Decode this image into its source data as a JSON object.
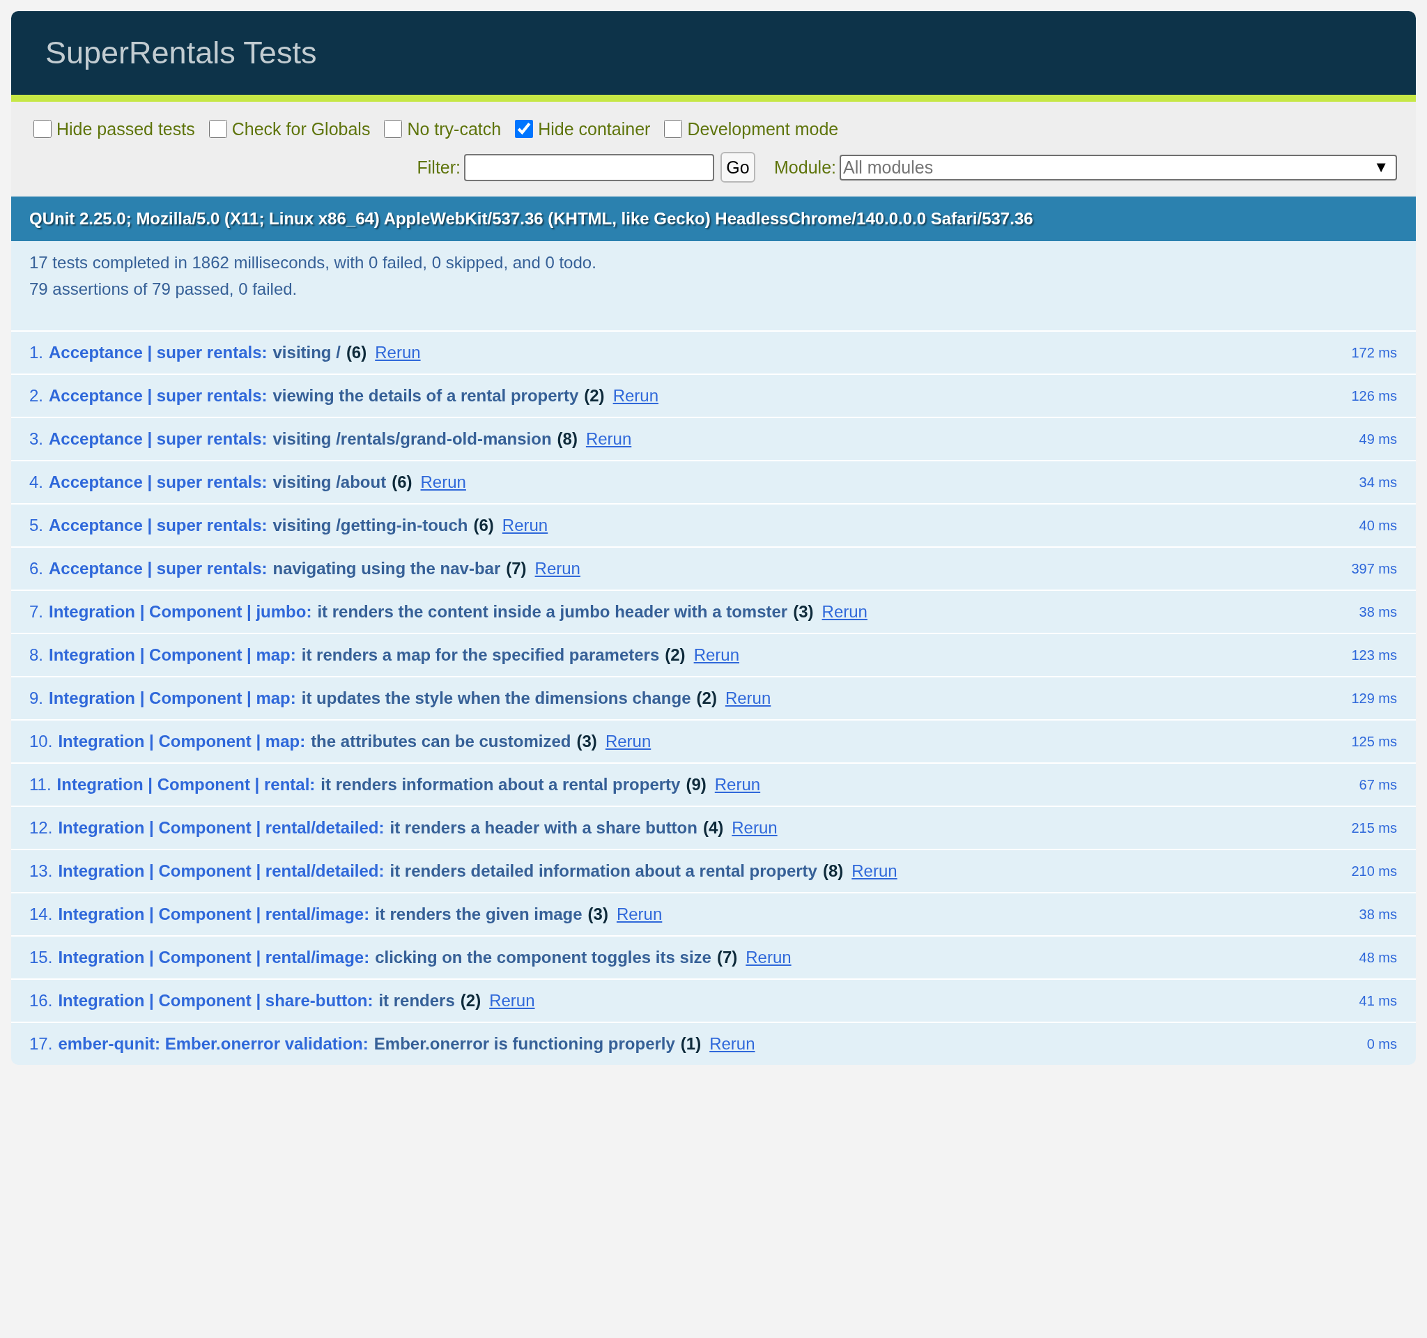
{
  "header": {
    "title": "SuperRentals Tests"
  },
  "banner": {
    "passed": true
  },
  "toolbar": {
    "options": [
      {
        "label": "Hide passed tests",
        "checked": false
      },
      {
        "label": "Check for Globals",
        "checked": false
      },
      {
        "label": "No try-catch",
        "checked": false
      },
      {
        "label": "Hide container",
        "checked": true
      },
      {
        "label": "Development mode",
        "checked": false
      }
    ],
    "filter": {
      "label": "Filter:",
      "button": "Go"
    },
    "module": {
      "label": "Module:",
      "placeholder": "All modules",
      "arrow": "▼"
    }
  },
  "user_agent": "QUnit 2.25.0; Mozilla/5.0 (X11; Linux x86_64) AppleWebKit/537.36 (KHTML, like Gecko) HeadlessChrome/140.0.0.0 Safari/537.36",
  "summary": {
    "tests_line": "17 tests completed in 1862 milliseconds, with 0 failed, 0 skipped, and 0 todo.",
    "assertions_line": "79 assertions of 79 passed, 0 failed."
  },
  "tests": [
    {
      "number": "1.",
      "module": "Acceptance | super rentals:",
      "name": "visiting /",
      "count": "(6)",
      "rerun": "Rerun",
      "runtime": "172 ms",
      "passed": true
    },
    {
      "number": "2.",
      "module": "Acceptance | super rentals:",
      "name": "viewing the details of a rental property",
      "count": "(2)",
      "rerun": "Rerun",
      "runtime": "126 ms",
      "passed": true
    },
    {
      "number": "3.",
      "module": "Acceptance | super rentals:",
      "name": "visiting /rentals/grand-old-mansion",
      "count": "(8)",
      "rerun": "Rerun",
      "runtime": "49 ms",
      "passed": true
    },
    {
      "number": "4.",
      "module": "Acceptance | super rentals:",
      "name": "visiting /about",
      "count": "(6)",
      "rerun": "Rerun",
      "runtime": "34 ms",
      "passed": true
    },
    {
      "number": "5.",
      "module": "Acceptance | super rentals:",
      "name": "visiting /getting-in-touch",
      "count": "(6)",
      "rerun": "Rerun",
      "runtime": "40 ms",
      "passed": true
    },
    {
      "number": "6.",
      "module": "Acceptance | super rentals:",
      "name": "navigating using the nav-bar",
      "count": "(7)",
      "rerun": "Rerun",
      "runtime": "397 ms",
      "passed": true
    },
    {
      "number": "7.",
      "module": "Integration | Component | jumbo:",
      "name": "it renders the content inside a jumbo header with a tomster",
      "count": "(3)",
      "rerun": "Rerun",
      "runtime": "38 ms",
      "passed": true
    },
    {
      "number": "8.",
      "module": "Integration | Component | map:",
      "name": "it renders a map for the specified parameters",
      "count": "(2)",
      "rerun": "Rerun",
      "runtime": "123 ms",
      "passed": true
    },
    {
      "number": "9.",
      "module": "Integration | Component | map:",
      "name": "it updates the style when the dimensions change",
      "count": "(2)",
      "rerun": "Rerun",
      "runtime": "129 ms",
      "passed": true
    },
    {
      "number": "10.",
      "module": "Integration | Component | map:",
      "name": "the attributes can be customized",
      "count": "(3)",
      "rerun": "Rerun",
      "runtime": "125 ms",
      "passed": true
    },
    {
      "number": "11.",
      "module": "Integration | Component | rental:",
      "name": "it renders information about a rental property",
      "count": "(9)",
      "rerun": "Rerun",
      "runtime": "67 ms",
      "passed": true
    },
    {
      "number": "12.",
      "module": "Integration | Component | rental/detailed:",
      "name": "it renders a header with a share button",
      "count": "(4)",
      "rerun": "Rerun",
      "runtime": "215 ms",
      "passed": true
    },
    {
      "number": "13.",
      "module": "Integration | Component | rental/detailed:",
      "name": "it renders detailed information about a rental property",
      "count": "(8)",
      "rerun": "Rerun",
      "runtime": "210 ms",
      "passed": true
    },
    {
      "number": "14.",
      "module": "Integration | Component | rental/image:",
      "name": "it renders the given image",
      "count": "(3)",
      "rerun": "Rerun",
      "runtime": "38 ms",
      "passed": true
    },
    {
      "number": "15.",
      "module": "Integration | Component | rental/image:",
      "name": "clicking on the component toggles its size",
      "count": "(7)",
      "rerun": "Rerun",
      "runtime": "48 ms",
      "passed": true
    },
    {
      "number": "16.",
      "module": "Integration | Component | share-button:",
      "name": "it renders",
      "count": "(2)",
      "rerun": "Rerun",
      "runtime": "41 ms",
      "passed": true
    },
    {
      "number": "17.",
      "module": "ember-qunit: Ember.onerror validation:",
      "name": "Ember.onerror is functioning properly",
      "count": "(1)",
      "rerun": "Rerun",
      "runtime": "0 ms",
      "passed": true
    }
  ]
}
